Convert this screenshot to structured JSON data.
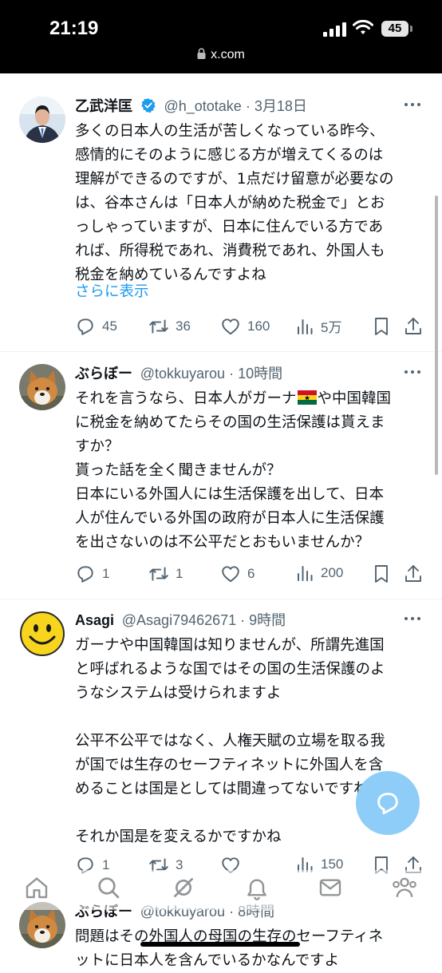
{
  "status_bar": {
    "time": "21:19",
    "battery": "45",
    "url": "x.com"
  },
  "tweets": [
    {
      "name": "乙武洋匡",
      "verified": true,
      "handle": "@h_ototake",
      "time": "3月18日",
      "text": "多くの日本人の生活が苦しくなっている昨今、\n感情的にそのように感じる方が増えてくるのは\n理解ができるのですが、1点だけ留意が必要なの\nは、谷本さんは「日本人が納めた税金で」とお\nっしゃっていますが、日本に住んでいる方であ\nれば、所得税であれ、消費税であれ、外国人も\n税金を納めているんですよね",
      "show_more": "さらに表示",
      "replies": "45",
      "retweets": "36",
      "likes": "160",
      "views": "5万"
    },
    {
      "name": "ぶらぼー",
      "handle": "@tokkuyarou",
      "time": "10時間",
      "text_before_flag": "それを言うなら、日本人がガーナ",
      "text_after_flag": "や中国韓国\nに税金を納めてたらその国の生活保護は貰えま\nすか？\n貰った話を全く聞きませんが？\n日本にいる外国人には生活保護を出して、日本\n人が住んでいる外国の政府が日本人に生活保護\nを出さないのは不公平だとおもいませんか？",
      "replies": "1",
      "retweets": "1",
      "likes": "6",
      "views": "200"
    },
    {
      "name": "Asagi",
      "handle": "@Asagi79462671",
      "time": "9時間",
      "text": "ガーナや中国韓国は知りませんが、所謂先進国\nと呼ばれるような国ではその国の生活保護のよ\nうなシステムは受けられますよ\n\n公平不公平ではなく、人権天賦の立場を取る我\nが国では生存のセーフティネットに外国人を含\nめることは国是としては間違ってないですね\n\nそれか国是を変えるかですかね",
      "replies": "1",
      "retweets": "3",
      "views": "150"
    },
    {
      "name": "ぶらぼー",
      "handle": "@tokkuyarou",
      "time": "8時間",
      "text": "問題はその外国人の母国の生存のセーフティネ\nットに日本人を含んでいるかなんですよ"
    }
  ],
  "colors": {
    "accent": "#1d9bf0",
    "secondary_text": "#536471",
    "fab": "#8ecdf7"
  },
  "icons": [
    "lock-icon",
    "verified-badge-icon",
    "more-icon",
    "reply-icon",
    "retweet-icon",
    "like-icon",
    "views-icon",
    "bookmark-icon",
    "share-icon",
    "compose-icon",
    "home-icon",
    "search-icon",
    "grok-icon",
    "notifications-icon",
    "messages-icon",
    "communities-icon"
  ]
}
